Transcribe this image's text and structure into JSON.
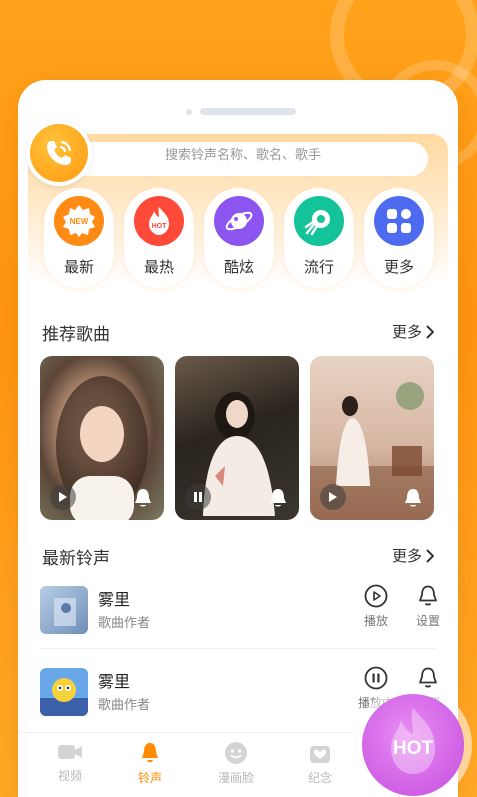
{
  "search": {
    "placeholder": "搜索铃声名称、歌名、歌手"
  },
  "categories": [
    {
      "label": "最新",
      "badge": "NEW",
      "color": "#ff8a14",
      "icon": "new-badge-icon"
    },
    {
      "label": "最热",
      "badge": "HOT",
      "color": "#ff4a3a",
      "icon": "hot-flame-icon"
    },
    {
      "label": "酷炫",
      "badge": "",
      "color": "#8c55ef",
      "icon": "planet-icon"
    },
    {
      "label": "流行",
      "badge": "",
      "color": "#15c39a",
      "icon": "rocket-icon"
    },
    {
      "label": "更多",
      "badge": "",
      "color": "#4e6bf0",
      "icon": "grid-icon"
    }
  ],
  "recommended": {
    "title": "推荐歌曲",
    "more": "更多",
    "cards": [
      {
        "state": "play"
      },
      {
        "state": "pause"
      },
      {
        "state": "play"
      }
    ]
  },
  "latest": {
    "title": "最新铃声",
    "more": "更多",
    "items": [
      {
        "title": "雾里",
        "artist": "歌曲作者",
        "action1": "播放",
        "action2": "设置"
      },
      {
        "title": "雾里",
        "artist": "歌曲作者",
        "action1": "播放中",
        "action2": "设置"
      }
    ]
  },
  "tabs": [
    {
      "label": "视频",
      "active": false
    },
    {
      "label": "铃声",
      "active": true
    },
    {
      "label": "漫画脸",
      "active": false
    },
    {
      "label": "纪念",
      "active": false
    }
  ],
  "fab": {
    "label": "HOT"
  },
  "colors": {
    "accent": "#ff9a10",
    "active_tab": "#ff8c00"
  }
}
